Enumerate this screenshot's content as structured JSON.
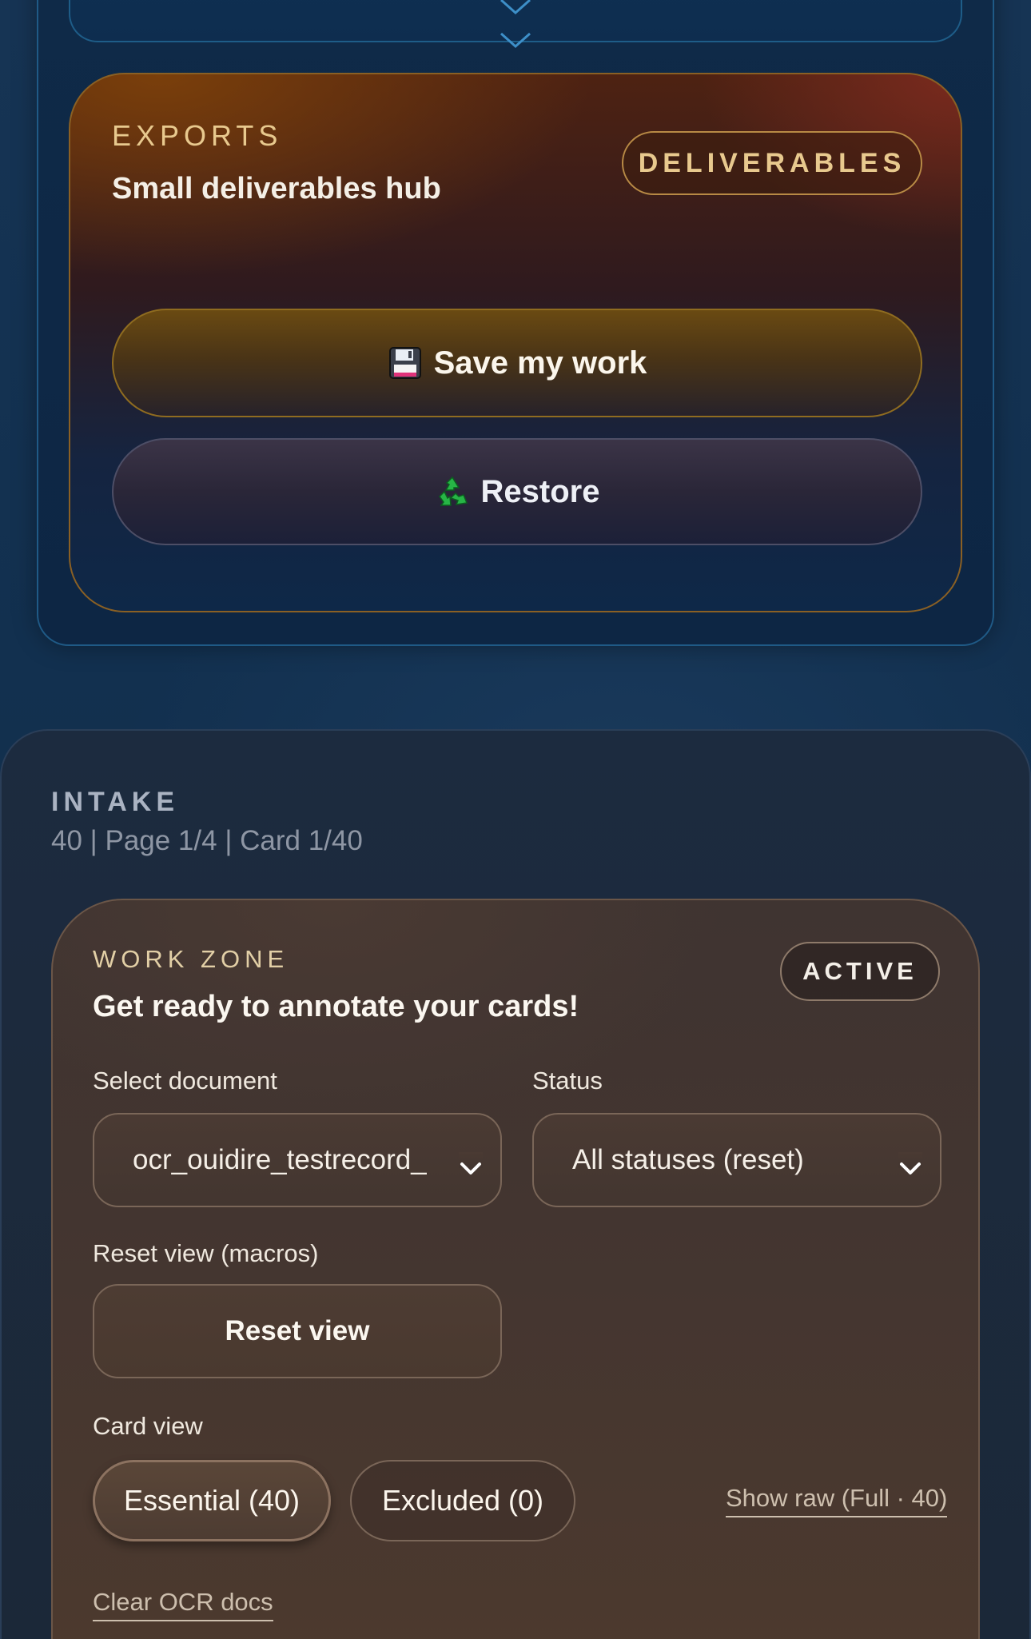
{
  "exports": {
    "eyebrow": "EXPORTS",
    "title": "Small deliverables hub",
    "badge": "DELIVERABLES",
    "save_label": "Save my work",
    "save_icon": "floppy-disk-icon",
    "restore_label": "Restore",
    "restore_icon": "recycle-icon"
  },
  "intake": {
    "eyebrow": "INTAKE",
    "meta": "40 | Page 1/4 | Card 1/40"
  },
  "work_zone": {
    "eyebrow": "WORK ZONE",
    "title": "Get ready to annotate your cards!",
    "badge": "ACTIVE",
    "document_label": "Select document",
    "document_value": "ocr_ouidire_testrecord_",
    "status_label": "Status",
    "status_value": "All statuses (reset)",
    "reset_label": "Reset view (macros)",
    "reset_button": "Reset view",
    "card_view_label": "Card view",
    "pill_essential": "Essential (40)",
    "pill_excluded": "Excluded (0)",
    "show_raw": "Show raw (Full · 40)",
    "clear_ocr": "Clear OCR docs"
  },
  "colors": {
    "gold_accent": "#e8c98e",
    "panel_blue": "#0f2a48",
    "intake_bg": "#1c2b3f",
    "work_zone_brown": "#433530"
  }
}
